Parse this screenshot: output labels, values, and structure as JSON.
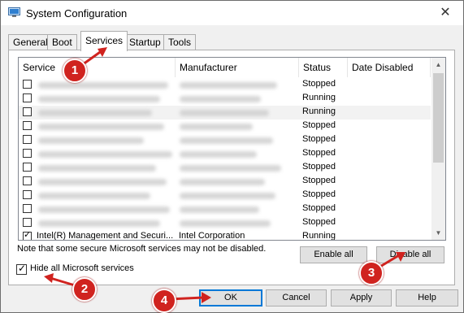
{
  "window": {
    "title": "System Configuration",
    "close_glyph": "✕"
  },
  "tabs": [
    {
      "label": "General"
    },
    {
      "label": "Boot"
    },
    {
      "label": "Services"
    },
    {
      "label": "Startup"
    },
    {
      "label": "Tools"
    }
  ],
  "columns": {
    "service": "Service",
    "manufacturer": "Manufacturer",
    "status": "Status",
    "date_disabled": "Date Disabled"
  },
  "rows": [
    {
      "checked": false,
      "service": "",
      "manufacturer": "",
      "status": "Stopped"
    },
    {
      "checked": false,
      "service": "",
      "manufacturer": "",
      "status": "Running"
    },
    {
      "checked": false,
      "service": "",
      "manufacturer": "",
      "status": "Running"
    },
    {
      "checked": false,
      "service": "",
      "manufacturer": "",
      "status": "Stopped"
    },
    {
      "checked": false,
      "service": "",
      "manufacturer": "",
      "status": "Stopped"
    },
    {
      "checked": false,
      "service": "",
      "manufacturer": "",
      "status": "Stopped"
    },
    {
      "checked": false,
      "service": "",
      "manufacturer": "",
      "status": "Stopped"
    },
    {
      "checked": false,
      "service": "",
      "manufacturer": "",
      "status": "Stopped"
    },
    {
      "checked": false,
      "service": "",
      "manufacturer": "",
      "status": "Stopped"
    },
    {
      "checked": false,
      "service": "",
      "manufacturer": "",
      "status": "Stopped"
    },
    {
      "checked": false,
      "service": "",
      "manufacturer": "",
      "status": "Stopped"
    },
    {
      "checked": true,
      "service": "Intel(R) Management and Securi...",
      "manufacturer": "Intel Corporation",
      "status": "Running"
    }
  ],
  "note": "Note that some secure Microsoft services may not be disabled.",
  "buttons": {
    "enable_all": "Enable all",
    "disable_all": "Disable all",
    "ok": "OK",
    "cancel": "Cancel",
    "apply": "Apply",
    "help": "Help"
  },
  "hide_ms": {
    "label": "Hide all Microsoft services",
    "checked": true
  },
  "annotations": [
    "1",
    "2",
    "3",
    "4"
  ],
  "colors": {
    "badge": "#d0231f",
    "accent": "#0078d7"
  }
}
